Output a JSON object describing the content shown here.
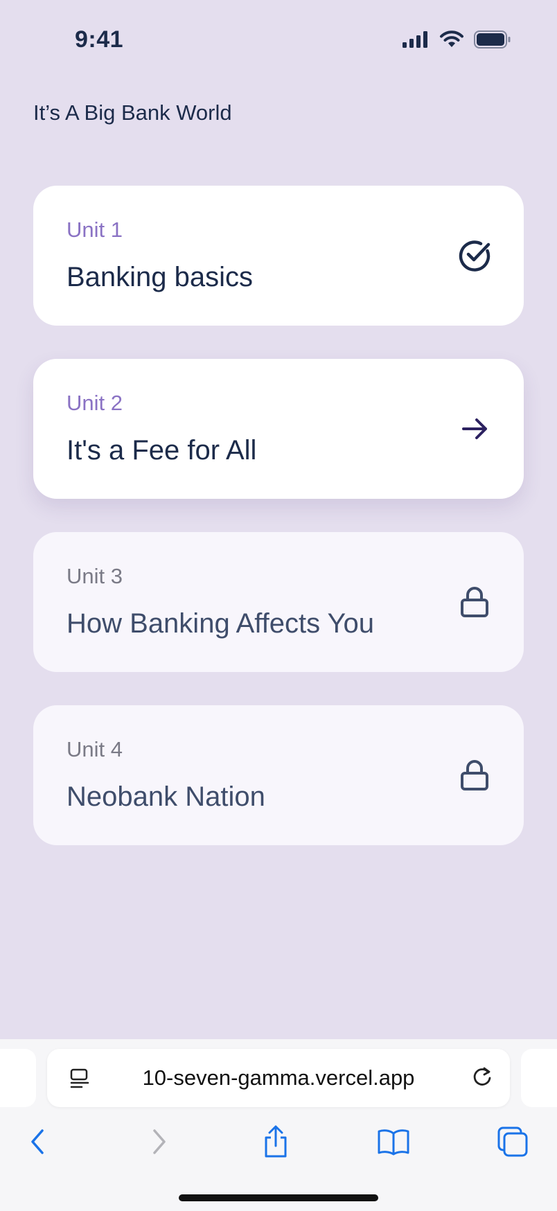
{
  "status_bar": {
    "time": "9:41"
  },
  "page": {
    "title": "It’s A Big Bank World"
  },
  "units": [
    {
      "label": "Unit 1",
      "title": "Banking basics",
      "state": "completed",
      "icon": "check-circle-icon"
    },
    {
      "label": "Unit 2",
      "title": "It's a Fee for All",
      "state": "current",
      "icon": "arrow-right-icon"
    },
    {
      "label": "Unit 3",
      "title": "How Banking Affects You",
      "state": "locked",
      "icon": "lock-icon"
    },
    {
      "label": "Unit 4",
      "title": "Neobank Nation",
      "state": "locked",
      "icon": "lock-icon"
    }
  ],
  "browser": {
    "url": "10-seven-gamma.vercel.app",
    "toolbar": [
      "back-icon",
      "forward-icon",
      "share-icon",
      "bookmarks-icon",
      "tabs-icon"
    ]
  },
  "colors": {
    "background": "#e4deee",
    "card": "#ffffff",
    "locked_card": "#f8f6fc",
    "accent": "#8a72c4",
    "text": "#1c2b4a",
    "arrow": "#2c2160",
    "browser_blue": "#1a73e8"
  }
}
